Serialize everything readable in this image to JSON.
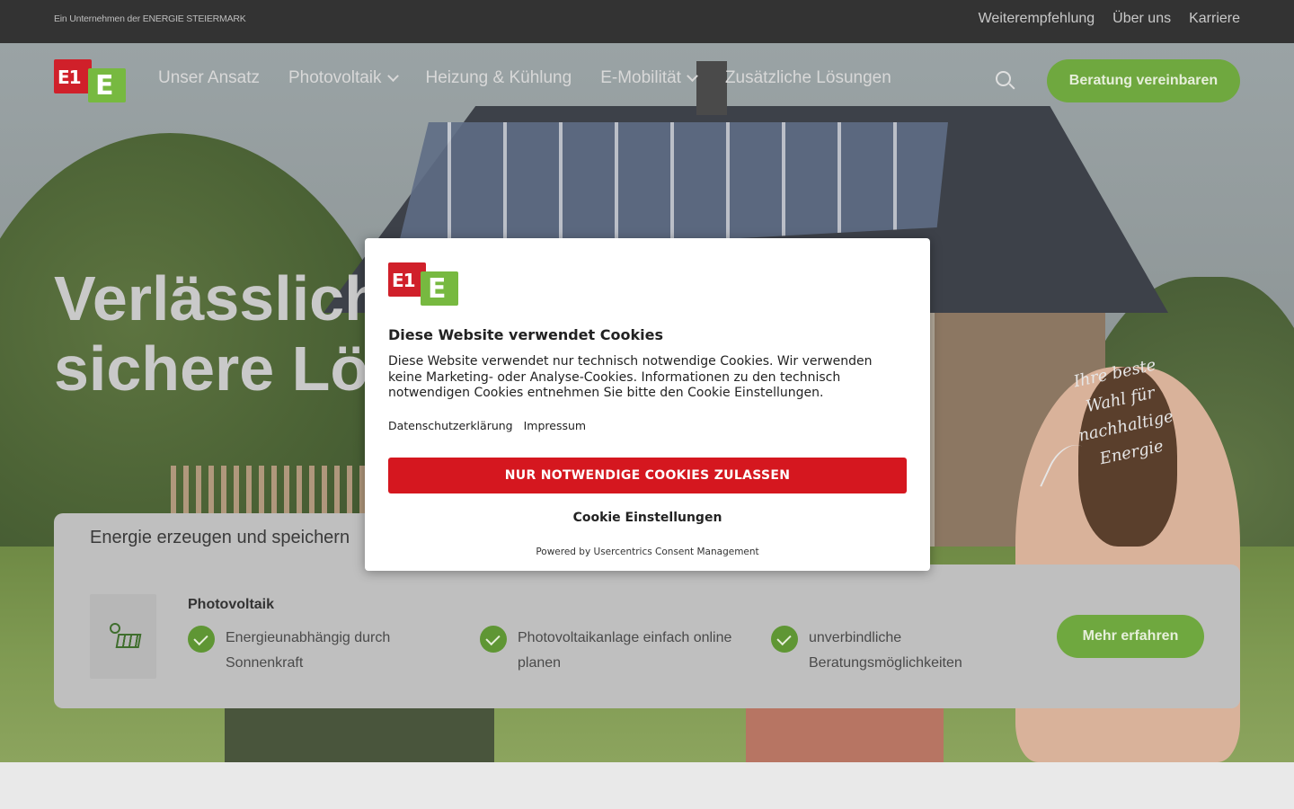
{
  "topbar": {
    "parent_company": "Ein Unternehmen der ENERGIE STEIERMARK",
    "links": [
      "Weiterempfehlung",
      "Über uns",
      "Karriere"
    ]
  },
  "logo": {
    "red_text": "E1",
    "green_text": "E"
  },
  "nav": {
    "items": [
      {
        "label": "Unser Ansatz",
        "has_dropdown": false
      },
      {
        "label": "Photovoltaik",
        "has_dropdown": true
      },
      {
        "label": "Heizung & Kühlung",
        "has_dropdown": false
      },
      {
        "label": "E-Mobilität",
        "has_dropdown": true
      },
      {
        "label": "Zusätzliche Lösungen",
        "has_dropdown": false
      }
    ],
    "search_icon": "search-icon",
    "cta_label": "Beratung vereinbaren"
  },
  "hero": {
    "headline_line1": "Verlässliche",
    "headline_line2": "sichere Lösu",
    "tagline_line1": "Ihre beste",
    "tagline_line2": "Wahl für nachhaltige",
    "tagline_line3": "Energie"
  },
  "card": {
    "tab_label": "Energie erzeugen und speichern",
    "icon": "solar-panel-icon",
    "title": "Photovoltaik",
    "features": [
      "Energieunabhängig durch Sonnenkraft",
      "Photovoltaikanlage einfach online planen",
      "unverbindliche Beratungsmöglichkeiten"
    ],
    "button_label": "Mehr erfahren"
  },
  "cookie_dialog": {
    "title": "Diese Website verwendet Cookies",
    "body": "Diese Website verwendet nur technisch notwendige Cookies. Wir verwenden keine Marketing- oder Analyse-Cookies. Informationen zu den technisch notwendigen Cookies entnehmen Sie bitte den Cookie Einstellungen.",
    "links": [
      "Datenschutzerklärung",
      "Impressum"
    ],
    "accept_label": "NUR NOTWENDIGE COOKIES ZULASSEN",
    "settings_label": "Cookie Einstellungen",
    "powered_by": "Powered by Usercentrics Consent Management"
  },
  "colors": {
    "brand_red": "#d0202a",
    "brand_green": "#77b940",
    "cta_green": "#6fa83f",
    "accept_red": "#d5171f",
    "topbar": "#333333"
  }
}
